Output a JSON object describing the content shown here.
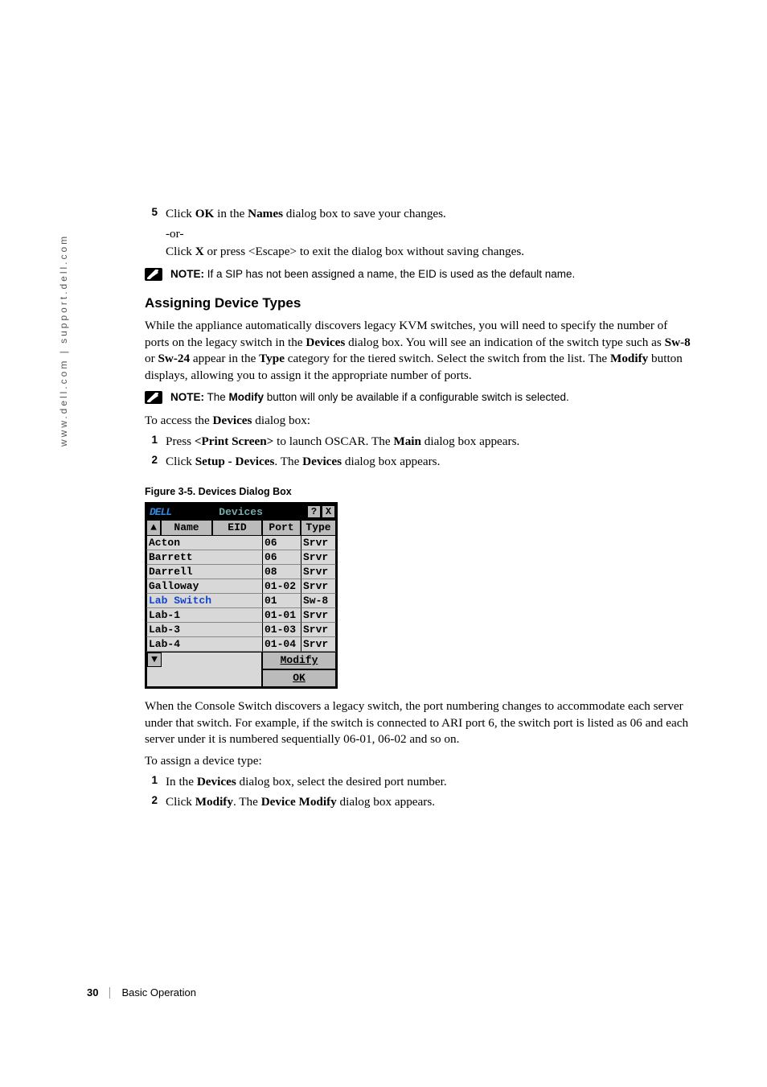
{
  "sidebar": {
    "url": "www.dell.com | support.dell.com"
  },
  "step5": {
    "num": "5",
    "line1_a": "Click ",
    "line1_b": "OK",
    "line1_c": " in the ",
    "line1_d": "Names",
    "line1_e": " dialog box to save your changes.",
    "or": "-or-",
    "line2_a": "Click ",
    "line2_b": "X",
    "line2_c": " or press <Escape> to exit the dialog box without saving changes."
  },
  "note1": {
    "label": "NOTE:",
    "text": " If a SIP has not been assigned a name, the EID is used as the default name."
  },
  "heading": "Assigning Device Types",
  "para1": {
    "a": "While the appliance automatically discovers legacy KVM switches, you will need to specify the number of ports on the legacy switch in the ",
    "b": "Devices",
    "c": " dialog box. You will see an indication of the switch type such as ",
    "d": "Sw-8",
    "e": " or ",
    "f": "Sw-24",
    "g": " appear in the ",
    "h": "Type",
    "i": " category for the tiered switch. Select the switch from the list. The ",
    "j": "Modify",
    "k": " button displays, allowing you to assign it the appropriate number of ports."
  },
  "note2": {
    "label": "NOTE:",
    "a": " The ",
    "b": "Modify",
    "c": " button will only be available if a configurable switch is selected."
  },
  "para2": {
    "a": "To access the ",
    "b": "Devices",
    "c": " dialog box:"
  },
  "stepA": {
    "num": "1",
    "a": "Press ",
    "b": "<Print Screen>",
    "c": " to launch OSCAR. The ",
    "d": "Main",
    "e": " dialog box appears."
  },
  "stepB": {
    "num": "2",
    "a": "Click ",
    "b": "Setup - Devices",
    "c": ". The ",
    "d": "Devices",
    "e": " dialog box appears."
  },
  "figcap": "Figure 3-5.    Devices Dialog Box",
  "dialog": {
    "logo": "DELL",
    "title": "Devices",
    "help": "?",
    "close": "X",
    "up": "▲",
    "down": "▼",
    "headers": {
      "name": "Name",
      "eid": "EID",
      "port": "Port",
      "type": "Type"
    },
    "rows": [
      {
        "name": "Acton",
        "port": "06",
        "type": "Srvr",
        "sel": false
      },
      {
        "name": "Barrett",
        "port": "06",
        "type": "Srvr",
        "sel": false
      },
      {
        "name": "Darrell",
        "port": "08",
        "type": "Srvr",
        "sel": false
      },
      {
        "name": "Galloway",
        "port": "01-02",
        "type": "Srvr",
        "sel": false
      },
      {
        "name": "Lab Switch",
        "port": "01",
        "type": "Sw-8",
        "sel": true
      },
      {
        "name": "Lab-1",
        "port": "01-01",
        "type": "Srvr",
        "sel": false
      },
      {
        "name": "Lab-3",
        "port": "01-03",
        "type": "Srvr",
        "sel": false
      },
      {
        "name": "Lab-4",
        "port": "01-04",
        "type": "Srvr",
        "sel": false
      }
    ],
    "modify": "Modify",
    "ok": "OK"
  },
  "para3": "When the Console Switch discovers a legacy switch, the port numbering changes to accommodate each server under that switch. For example, if the switch is connected to ARI port 6, the switch port is listed as 06 and each server under it is numbered sequentially 06-01, 06-02 and so on.",
  "para4": "To assign a device type:",
  "stepC": {
    "num": "1",
    "a": "In the ",
    "b": "Devices",
    "c": " dialog box, select the desired port number."
  },
  "stepD": {
    "num": "2",
    "a": "Click ",
    "b": "Modify",
    "c": ". The ",
    "d": "Device Modify",
    "e": " dialog box appears."
  },
  "footer": {
    "page": "30",
    "chapter": "Basic Operation"
  }
}
